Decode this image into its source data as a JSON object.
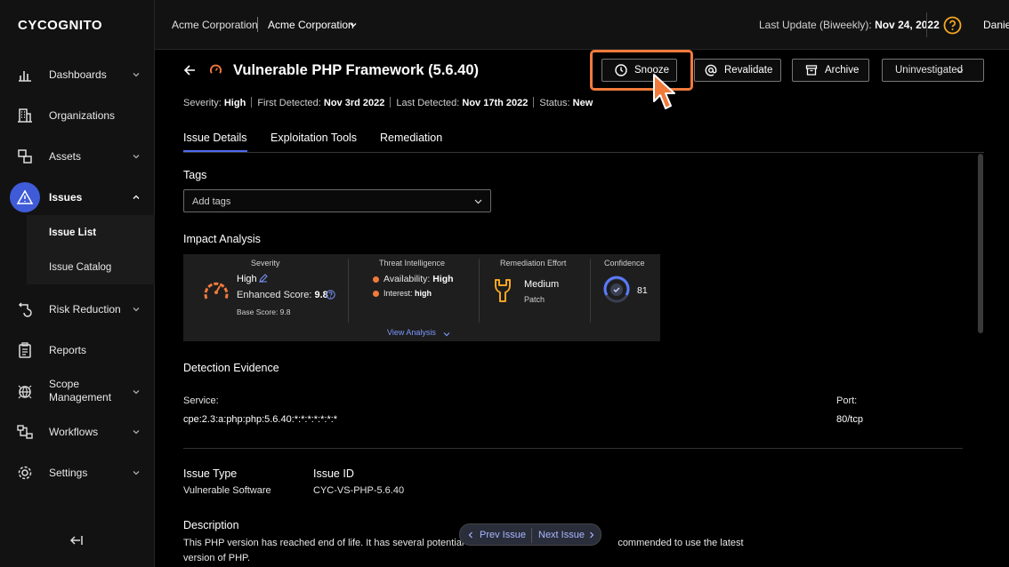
{
  "sidebar": {
    "logo": "CYCOGNITO",
    "items": [
      {
        "label": "Dashboards",
        "icon": "bar-chart-icon"
      },
      {
        "label": "Organizations",
        "icon": "building-icon"
      },
      {
        "label": "Assets",
        "icon": "assets-icon"
      },
      {
        "label": "Issues",
        "icon": "warning-triangle-icon"
      },
      {
        "label": "Risk Reduction",
        "icon": "risk-reduction-icon"
      },
      {
        "label": "Reports",
        "icon": "clipboard-icon"
      },
      {
        "label": "Scope",
        "label2": "Management",
        "icon": "globe-icon"
      },
      {
        "label": "Workflows",
        "icon": "workflow-icon"
      },
      {
        "label": "Settings",
        "icon": "gear-icon"
      }
    ],
    "sub_items": [
      "Issue List",
      "Issue Catalog"
    ]
  },
  "topbar": {
    "org_primary": "Acme Corporation",
    "org_secondary": "Acme Corporation",
    "update_label": "Last Update (Biweekly): ",
    "update_value": "Nov 24, 2022",
    "user": "Daniel"
  },
  "issue": {
    "title": "Vulnerable PHP Framework (5.6.40)",
    "buttons": {
      "snooze": "Snooze",
      "revalidate": "Revalidate",
      "archive": "Archive",
      "status": "Uninvestigated"
    },
    "meta": {
      "severity_label": "Severity: ",
      "severity": "High",
      "first_label": "First Detected: ",
      "first": "Nov 3rd 2022",
      "last_label": "Last Detected: ",
      "last": "Nov 17th 2022",
      "status_label": "Status: ",
      "status": "New"
    },
    "tabs": [
      "Issue Details",
      "Exploitation Tools",
      "Remediation"
    ],
    "tags": {
      "title": "Tags",
      "placeholder": "Add tags"
    },
    "impact": {
      "title": "Impact Analysis",
      "severity": {
        "head": "Severity",
        "value": "High",
        "enhanced_label": "Enhanced Score: ",
        "enhanced_value": "9.8",
        "base": "Base Score: 9.8"
      },
      "threat": {
        "head": "Threat Intelligence",
        "availability_label": "Availability: ",
        "availability": "High",
        "interest_label": "Interest: ",
        "interest": "high"
      },
      "remediation": {
        "head": "Remediation Effort",
        "value": "Medium",
        "sub": "Patch"
      },
      "confidence": {
        "head": "Confidence",
        "value": "81"
      },
      "view_analysis": "View Analysis"
    },
    "evidence": {
      "title": "Detection Evidence",
      "service_label": "Service:",
      "service_value": "cpe:2.3:a:php:php:5.6.40:*:*:*:*:*:*:*",
      "port_label": "Port:",
      "port_value": "80/tcp"
    },
    "issue_type": {
      "label": "Issue Type",
      "value": "Vulnerable Software"
    },
    "issue_id": {
      "label": "Issue ID",
      "value": "CYC-VS-PHP-5.6.40"
    },
    "description": {
      "label": "Description",
      "text": "This PHP version has reached end of life. It has several potential"
    },
    "description_tail": "commended to use the latest",
    "description_line2": "version of PHP.",
    "pager": {
      "prev": "Prev Issue",
      "next": "Next Issue"
    }
  },
  "colors": {
    "accent_blue": "#3f5bd8",
    "highlight_orange": "#f07a3c",
    "link_blue": "#7a98ff"
  }
}
